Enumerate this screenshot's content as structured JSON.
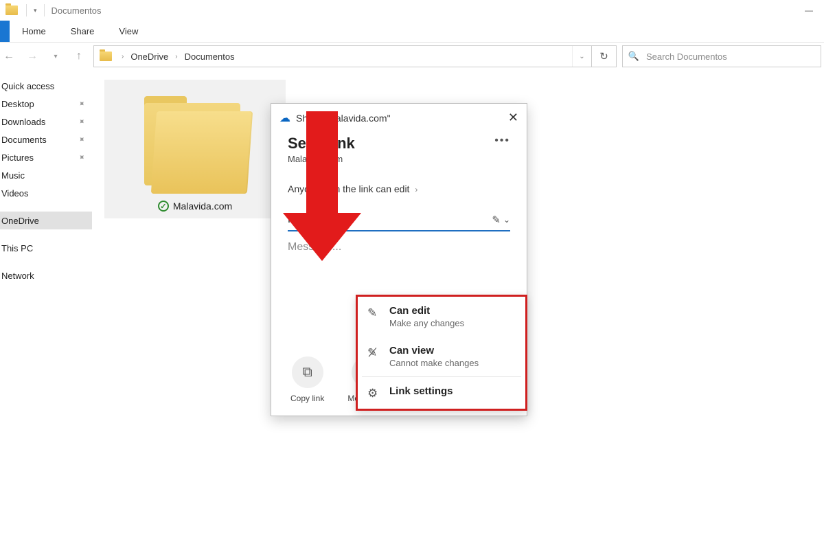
{
  "titlebar": {
    "title": "Documentos"
  },
  "ribbon": {
    "tabs": [
      "Home",
      "Share",
      "View"
    ]
  },
  "address": {
    "crumbs": [
      "OneDrive",
      "Documentos"
    ],
    "search_placeholder": "Search Documentos"
  },
  "sidebar": {
    "quick_access": "Quick access",
    "pinned": [
      "Desktop",
      "Downloads",
      "Documents",
      "Pictures"
    ],
    "plain": [
      "Music",
      "Videos"
    ],
    "groups": [
      "OneDrive",
      "This PC",
      "Network"
    ]
  },
  "content": {
    "folder_caption": "Malavida.com"
  },
  "dialog": {
    "header": "Share \"Malavida.com\"",
    "title": "Send link",
    "subtitle": "Malavida.com",
    "link_permission": "Anyone with the link can edit",
    "name_value": "Malavida",
    "message_placeholder": "Message...",
    "actions": {
      "copy_link": "Copy link",
      "more_apps": "More apps"
    }
  },
  "perm_panel": {
    "can_edit": {
      "title": "Can edit",
      "subtitle": "Make any changes"
    },
    "can_view": {
      "title": "Can view",
      "subtitle": "Cannot make changes"
    },
    "link_settings": {
      "title": "Link settings"
    }
  }
}
